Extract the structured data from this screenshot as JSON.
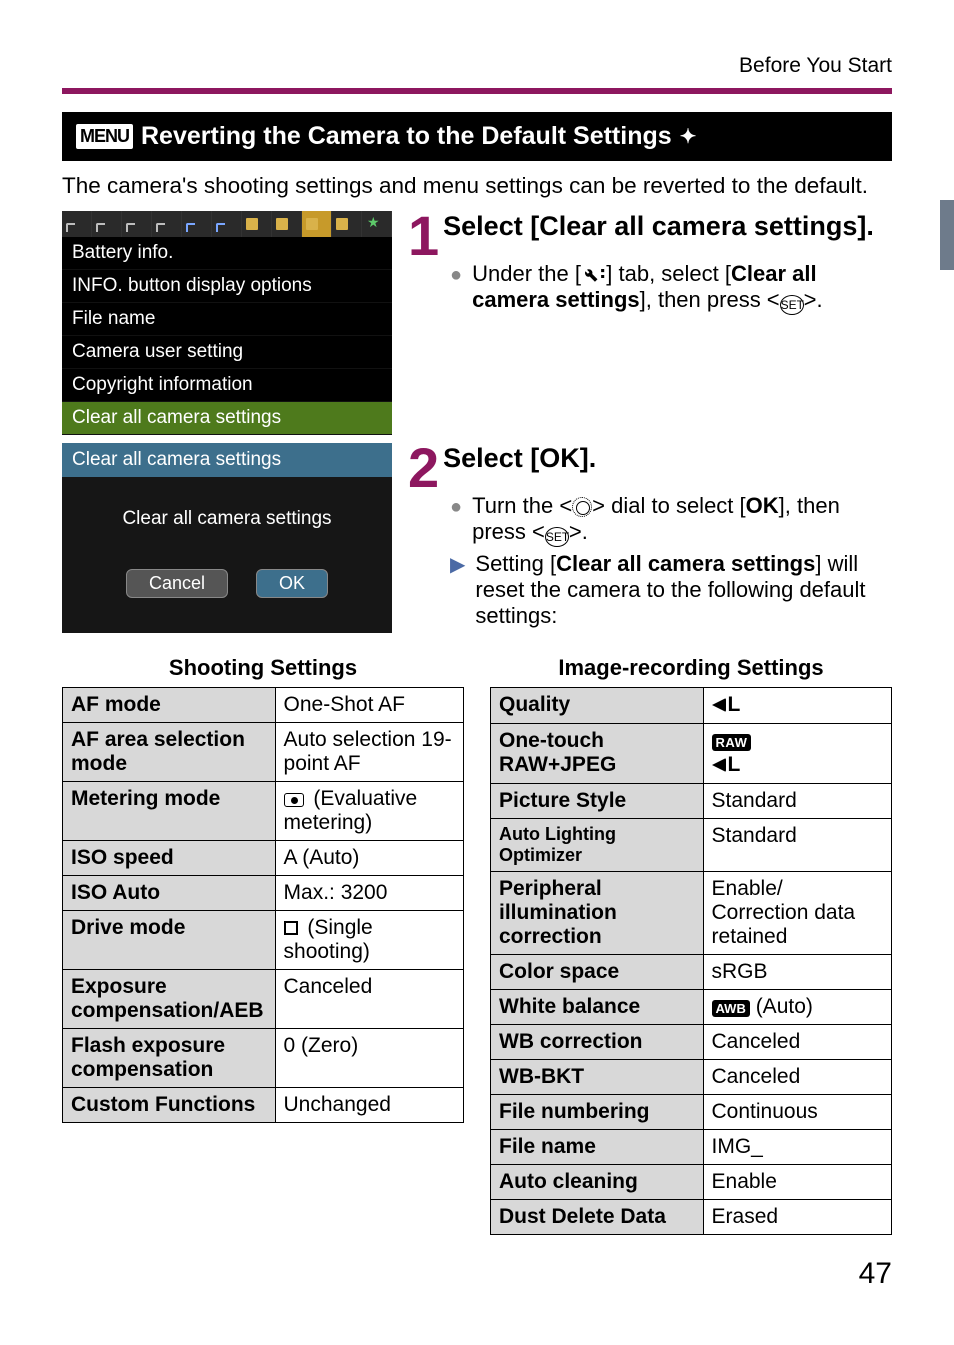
{
  "header": {
    "section": "Before You Start",
    "title": "Reverting the Camera to the Default Settings",
    "intro": "The camera's shooting settings and menu settings can be reverted to the default."
  },
  "screenshot1": {
    "items": [
      "Battery info.",
      "INFO. button display options",
      "File name",
      "Camera user setting",
      "Copyright information",
      "Clear all camera settings"
    ]
  },
  "screenshot2": {
    "title": "Clear all camera settings",
    "body": "Clear all camera settings",
    "cancel": "Cancel",
    "ok": "OK"
  },
  "step1": {
    "num": "1",
    "title": "Select [Clear all camera settings].",
    "bullet1a": "Under the [",
    "bullet1b": "] tab, select [",
    "bullet1c": "Clear all camera settings",
    "bullet1d": "], then press <",
    "bullet1e": ">."
  },
  "step2": {
    "num": "2",
    "title": "Select [OK].",
    "b1a": "Turn the <",
    "b1b": "> dial to select [",
    "b1c": "OK",
    "b1d": "], then press <",
    "b1e": ">.",
    "b2a": "Setting [",
    "b2b": "Clear all camera settings",
    "b2c": "] will reset the camera to the following default settings:"
  },
  "tables": {
    "left_caption": "Shooting Settings",
    "right_caption": "Image-recording Settings",
    "left_rows": [
      {
        "k": "AF mode",
        "v": "One-Shot AF"
      },
      {
        "k": "AF area selection mode",
        "v": "Auto selection 19-point AF"
      },
      {
        "k": "Metering mode",
        "v": " (Evaluative metering)",
        "meter": true
      },
      {
        "k": "ISO speed",
        "v": "A (Auto)"
      },
      {
        "k": "ISO Auto",
        "v": "Max.: 3200"
      },
      {
        "k": "Drive mode",
        "v": " (Single shooting)",
        "square": true
      },
      {
        "k": "Exposure compensation/AEB",
        "v": "Canceled"
      },
      {
        "k": "Flash exposure compensation",
        "v": "0 (Zero)"
      },
      {
        "k": "Custom Functions",
        "v": "Unchanged"
      }
    ],
    "right_rows": [
      {
        "k": "Quality",
        "v_special": "qL"
      },
      {
        "k": "One-touch RAW+JPEG",
        "v_special": "rawql"
      },
      {
        "k": "Picture Style",
        "v": "Standard"
      },
      {
        "k": "Auto Lighting Optimizer",
        "v": "Standard",
        "small": true
      },
      {
        "k": "Peripheral illumination correction",
        "v": "Enable/\nCorrection data retained"
      },
      {
        "k": "Color space",
        "v": "sRGB"
      },
      {
        "k": "White balance",
        "v": " (Auto)",
        "awb": true
      },
      {
        "k": "WB correction",
        "v": "Canceled"
      },
      {
        "k": "WB-BKT",
        "v": "Canceled"
      },
      {
        "k": "File numbering",
        "v": "Continuous"
      },
      {
        "k": "File name",
        "v": "IMG_"
      },
      {
        "k": "Auto cleaning",
        "v": "Enable"
      },
      {
        "k": "Dust Delete Data",
        "v": "Erased"
      }
    ]
  },
  "pagenum": "47"
}
